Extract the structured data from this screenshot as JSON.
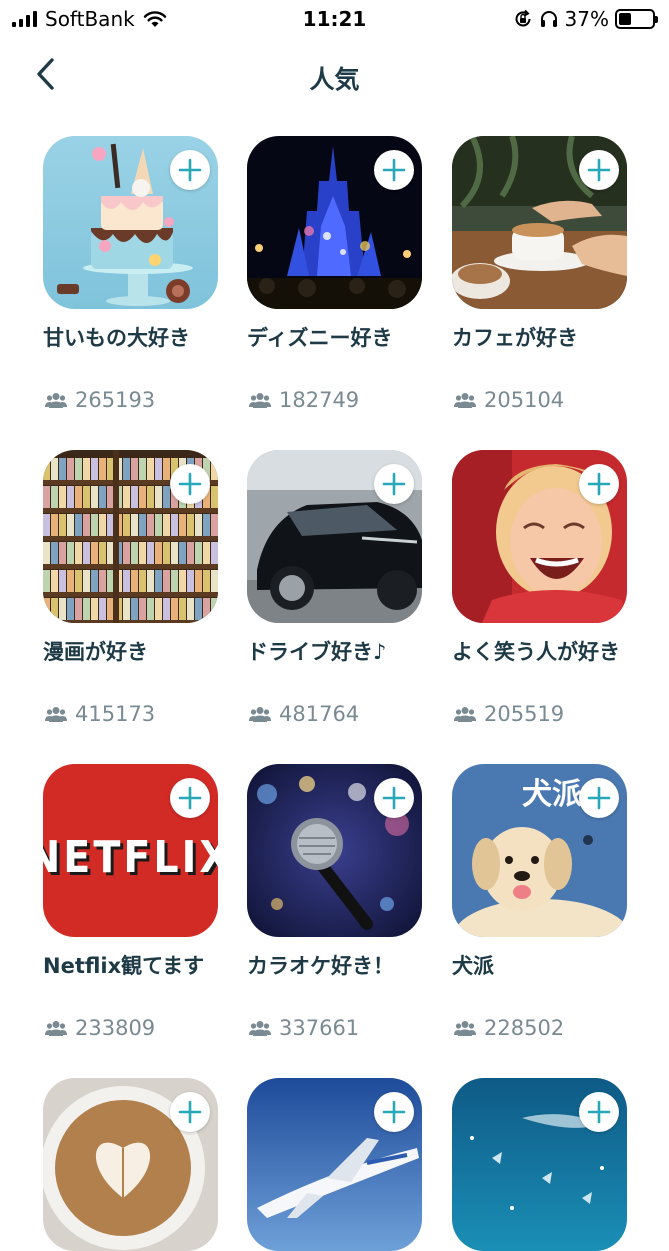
{
  "status_bar": {
    "carrier": "SoftBank",
    "time": "11:21",
    "battery_percent": "37%",
    "battery_level": 0.37,
    "icons": [
      "signal-icon",
      "wifi-icon",
      "orientation-lock-icon",
      "headphones-icon",
      "battery-icon"
    ]
  },
  "nav": {
    "title": "人気",
    "back_icon": "chevron-left-icon"
  },
  "colors": {
    "accent": "#26a8b8",
    "title_text": "#1d3a46",
    "count_text": "#7a8a92"
  },
  "items": [
    {
      "title": "甘いもの大好き",
      "count": "265193",
      "image": "cake-image"
    },
    {
      "title": "ディズニー好き",
      "count": "182749",
      "image": "castle-image"
    },
    {
      "title": "カフェが好き",
      "count": "205104",
      "image": "coffee-image"
    },
    {
      "title": "漫画が好き",
      "count": "415173",
      "image": "manga-shelf-image"
    },
    {
      "title": "ドライブ好き♪",
      "count": "481764",
      "image": "car-image"
    },
    {
      "title": "よく笑う人が好き",
      "count": "205519",
      "image": "laughing-child-image"
    },
    {
      "title": "Netflix観てます",
      "count": "233809",
      "image": "netflix-logo-image",
      "image_text": "NETFLIX"
    },
    {
      "title": "カラオケ好き！",
      "count": "337661",
      "image": "microphone-image"
    },
    {
      "title": "犬派",
      "count": "228502",
      "image": "dog-image",
      "image_text": "犬派"
    },
    {
      "title": "",
      "count": "",
      "image": "latte-art-image"
    },
    {
      "title": "",
      "count": "",
      "image": "airplane-image"
    },
    {
      "title": "",
      "count": "",
      "image": "aquarium-image"
    }
  ]
}
